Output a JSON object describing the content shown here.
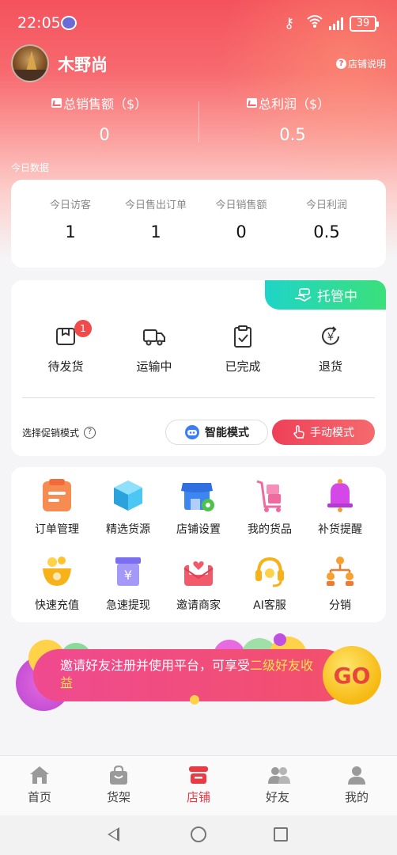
{
  "status_bar": {
    "time": "22:05",
    "battery": "39"
  },
  "header": {
    "shop_name": "木野尚",
    "help_label": "店铺说明"
  },
  "summary": {
    "total_sales_label": "总销售额（$）",
    "total_sales_value": "0",
    "total_profit_label": "总利润（$）",
    "total_profit_value": "0.5"
  },
  "today": {
    "section_label": "今日数据",
    "stats": [
      {
        "label": "今日访客",
        "value": "1"
      },
      {
        "label": "今日售出订单",
        "value": "1"
      },
      {
        "label": "今日销售额",
        "value": "0"
      },
      {
        "label": "今日利润",
        "value": "0.5"
      }
    ]
  },
  "orders": {
    "trust_label": "托管中",
    "items": [
      {
        "label": "待发货",
        "icon": "package-icon",
        "badge": "1"
      },
      {
        "label": "运输中",
        "icon": "truck-icon"
      },
      {
        "label": "已完成",
        "icon": "clipboard-check-icon"
      },
      {
        "label": "退货",
        "icon": "refund-icon"
      }
    ],
    "promo_mode_label": "选择促销模式",
    "smart_mode_label": "智能模式",
    "manual_mode_label": "手动模式"
  },
  "tools": [
    {
      "label": "订单管理",
      "icon": "order-management-icon"
    },
    {
      "label": "精选货源",
      "icon": "cube-icon"
    },
    {
      "label": "店铺设置",
      "icon": "shop-settings-icon"
    },
    {
      "label": "我的货品",
      "icon": "cart-goods-icon"
    },
    {
      "label": "补货提醒",
      "icon": "bell-icon"
    },
    {
      "label": "快速充值",
      "icon": "coins-bowl-icon"
    },
    {
      "label": "急速提现",
      "icon": "yuan-box-icon"
    },
    {
      "label": "邀请商家",
      "icon": "envelope-heart-icon"
    },
    {
      "label": "AI客服",
      "icon": "headset-icon"
    },
    {
      "label": "分销",
      "icon": "distribution-icon"
    }
  ],
  "banner": {
    "text_main": "邀请好友注册并使用平台，可享受",
    "text_highlight": "二级好友收益",
    "go_label": "GO"
  },
  "tabbar": [
    {
      "label": "首页",
      "icon": "home-icon"
    },
    {
      "label": "货架",
      "icon": "bag-icon"
    },
    {
      "label": "店铺",
      "icon": "store-icon",
      "active": true
    },
    {
      "label": "好友",
      "icon": "friends-icon"
    },
    {
      "label": "我的",
      "icon": "user-icon"
    }
  ],
  "colors": {
    "accent": "#ec3a45",
    "trust_gradient": "#1fd4c8",
    "highlight": "#ffe24a"
  }
}
